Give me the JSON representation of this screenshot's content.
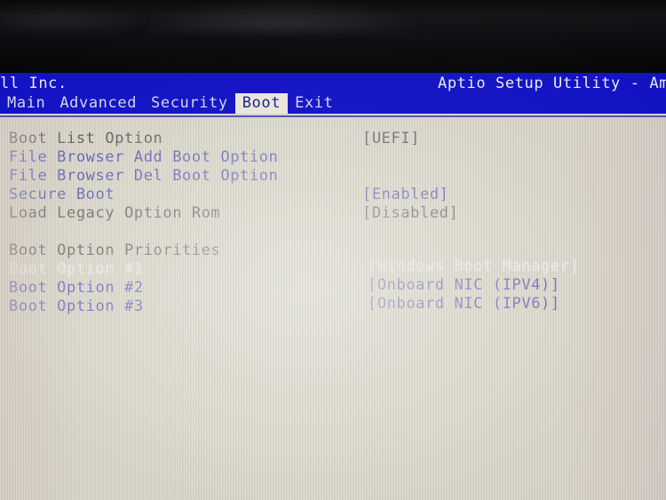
{
  "screen": {
    "vendor_text": "ll Inc.",
    "utility_title": "Aptio Setup Utility - Ameri"
  },
  "tabs": [
    {
      "label": "Main",
      "active": false
    },
    {
      "label": "Advanced",
      "active": false
    },
    {
      "label": "Security",
      "active": false
    },
    {
      "label": "Boot",
      "active": true
    },
    {
      "label": "Exit",
      "active": false
    }
  ],
  "settings": [
    {
      "label": "Boot List Option",
      "value": "[UEFI]",
      "label_style": "dark",
      "value_style": "dark"
    },
    {
      "label": "File Browser Add Boot Option",
      "value": "",
      "label_style": "blue",
      "value_style": "blue"
    },
    {
      "label": "File Browser Del Boot Option",
      "value": "",
      "label_style": "blue",
      "value_style": "blue"
    },
    {
      "label": "Secure Boot",
      "value": "[Enabled]",
      "label_style": "blue",
      "value_style": "blue"
    },
    {
      "label": "Load Legacy Option Rom",
      "value": "[Disabled]",
      "label_style": "dark",
      "value_style": "dark"
    }
  ],
  "priorities": {
    "heading": "Boot Option Priorities",
    "items": [
      {
        "label": "Boot Option #1",
        "value": "[Windows Boot Manager]",
        "label_style": "sel",
        "value_style": "sel"
      },
      {
        "label": "Boot Option #2",
        "value": "[Onboard NIC (IPV4)]",
        "label_style": "blue",
        "value_style": "blue"
      },
      {
        "label": "Boot Option #3",
        "value": "[Onboard NIC (IPV6)]",
        "label_style": "blue",
        "value_style": "blue"
      }
    ]
  },
  "colors": {
    "menu_blue": "#1111c4",
    "panel_cream": "#d9d5c9",
    "active_tab_bg": "#e9e5da",
    "text_blue": "#2e2eb4",
    "text_dark": "#35353a",
    "text_selected": "#f4f4ec"
  }
}
